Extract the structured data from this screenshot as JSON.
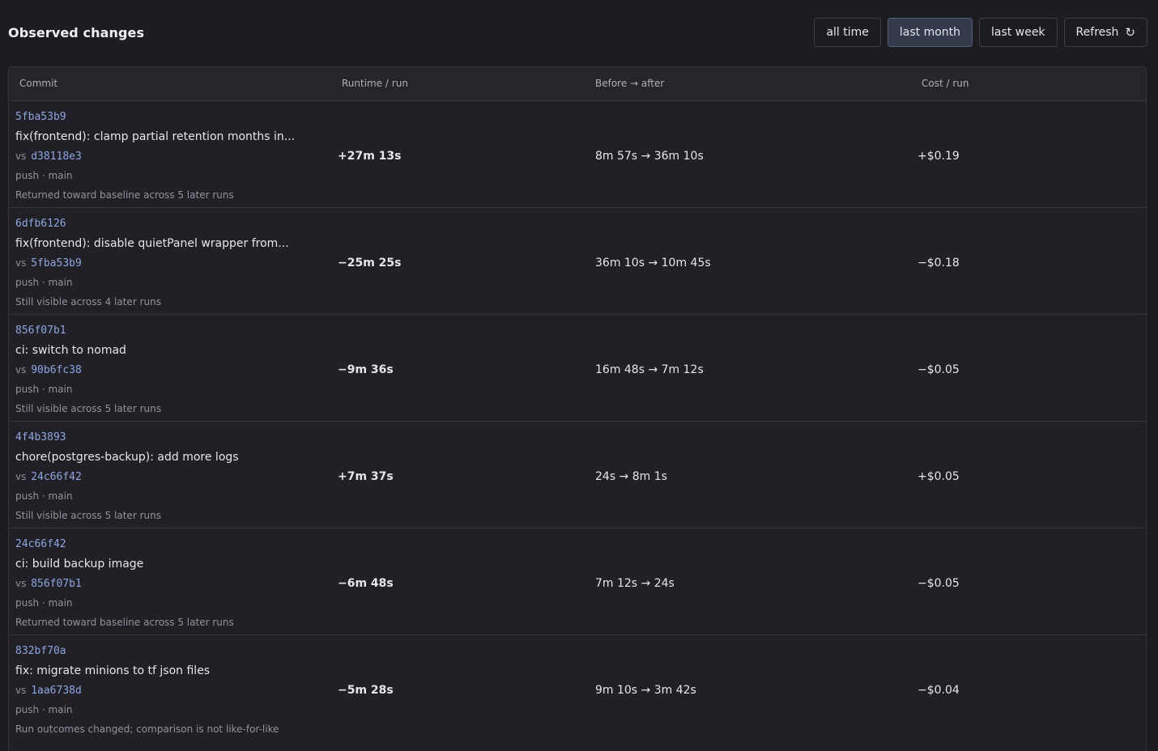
{
  "header": {
    "title": "Observed changes",
    "ranges": [
      "all time",
      "last month",
      "last week"
    ],
    "active_range": "last month",
    "refresh_label": "Refresh",
    "refresh_icon": "refresh-icon"
  },
  "table": {
    "columns": [
      "Commit",
      "Runtime / run",
      "Before → after",
      "Cost / run"
    ],
    "rows": [
      {
        "hash": "5fba53b9",
        "message": "fix(frontend): clamp partial retention months in...",
        "vs_label": "vs",
        "vs_hash": "d38118e3",
        "meta": "push · main",
        "note": "Returned toward baseline across 5 later runs",
        "runtime": "+27m 13s",
        "before_after": "8m 57s → 36m 10s",
        "cost": "+$0.19"
      },
      {
        "hash": "6dfb6126",
        "message": "fix(frontend): disable quietPanel wrapper from...",
        "vs_label": "vs",
        "vs_hash": "5fba53b9",
        "meta": "push · main",
        "note": "Still visible across 4 later runs",
        "runtime": "−25m 25s",
        "before_after": "36m 10s → 10m 45s",
        "cost": "−$0.18"
      },
      {
        "hash": "856f07b1",
        "message": "ci: switch to nomad",
        "vs_label": "vs",
        "vs_hash": "90b6fc38",
        "meta": "push · main",
        "note": "Still visible across 5 later runs",
        "runtime": "−9m 36s",
        "before_after": "16m 48s → 7m 12s",
        "cost": "−$0.05"
      },
      {
        "hash": "4f4b3893",
        "message": "chore(postgres-backup): add more logs",
        "vs_label": "vs",
        "vs_hash": "24c66f42",
        "meta": "push · main",
        "note": "Still visible across 5 later runs",
        "runtime": "+7m 37s",
        "before_after": "24s → 8m 1s",
        "cost": "+$0.05"
      },
      {
        "hash": "24c66f42",
        "message": "ci: build backup image",
        "vs_label": "vs",
        "vs_hash": "856f07b1",
        "meta": "push · main",
        "note": "Returned toward baseline across 5 later runs",
        "runtime": "−6m 48s",
        "before_after": "7m 12s → 24s",
        "cost": "−$0.05"
      },
      {
        "hash": "832bf70a",
        "message": "fix: migrate minions to tf json files",
        "vs_label": "vs",
        "vs_hash": "1aa6738d",
        "meta": "push · main",
        "note": "Run outcomes changed; comparison is not like-for-like",
        "runtime": "−5m 28s",
        "before_after": "9m 10s → 3m 42s",
        "cost": "−$0.04"
      }
    ]
  }
}
